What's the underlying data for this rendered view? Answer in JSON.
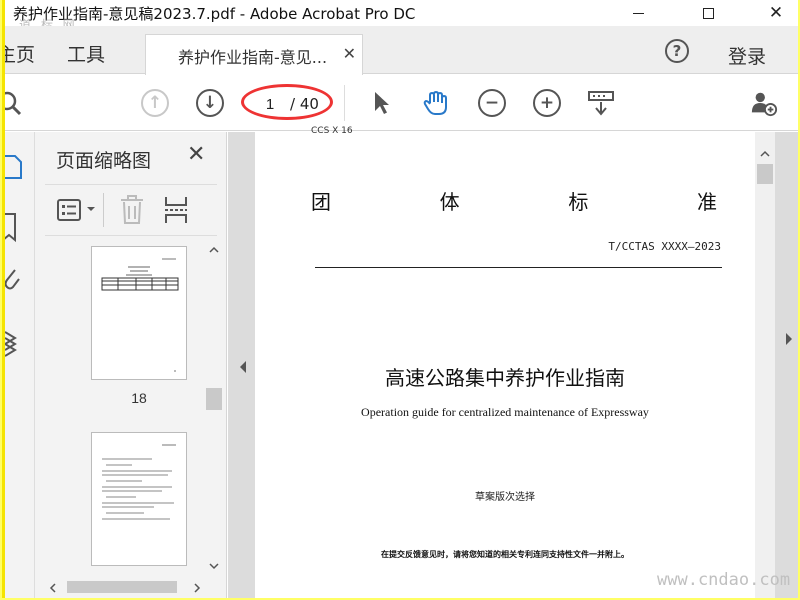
{
  "window": {
    "title": "养护作业指南-意见稿2023.7.pdf - Adobe Acrobat Pro DC",
    "minimize": "minimize",
    "maximize": "maximize",
    "close": "✕"
  },
  "watermark_top": "道 标 网",
  "tabs": {
    "home": "主页",
    "tools": "工具",
    "document": "养护作业指南-意见...",
    "document_close": "✕",
    "help": "?",
    "login": "登录"
  },
  "toolbar": {
    "page_current": "1",
    "page_total": "/ 40",
    "icons": [
      "search-icon",
      "page-up-icon",
      "page-down-icon",
      "select-arrow-icon",
      "hand-icon",
      "zoom-out-icon",
      "zoom-in-icon",
      "keyboard-marquee-icon",
      "add-user-icon"
    ]
  },
  "panel": {
    "title": "页面缩略图",
    "close": "✕",
    "thumbnails": [
      {
        "label": "18"
      },
      {
        "label": ""
      }
    ]
  },
  "document": {
    "code": "CCS X 16",
    "heading": [
      "团",
      "体",
      "标",
      "准"
    ],
    "std_number": "T/CCTAS XXXX—2023",
    "title": "高速公路集中养护作业指南",
    "subtitle": "Operation guide for centralized maintenance of Expressway",
    "draft": "草案版次选择",
    "note": "在提交反馈意见时，请将您知道的相关专利连同支持性文件一并附上。"
  },
  "watermark_bottom": "www.cndao.com",
  "colors": {
    "highlight_oval": "#ee3333",
    "frame_border": "#f5e400"
  }
}
